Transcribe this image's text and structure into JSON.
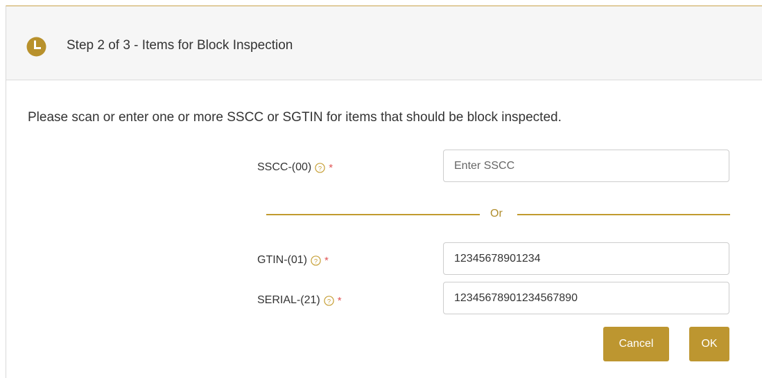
{
  "header": {
    "title": "Step 2 of 3 - Items for Block Inspection",
    "icon": "clock-icon"
  },
  "instruction": "Please scan or enter one or more SSCC or SGTIN for items that should be block inspected.",
  "form": {
    "sscc": {
      "label": "SSCC-(00)",
      "required_marker": "*",
      "placeholder": "Enter SSCC",
      "value": ""
    },
    "separator": "Or",
    "gtin": {
      "label": "GTIN-(01)",
      "required_marker": "*",
      "value": "12345678901234"
    },
    "serial": {
      "label": "SERIAL-(21)",
      "required_marker": "*",
      "value": "12345678901234567890"
    }
  },
  "buttons": {
    "cancel": "Cancel",
    "ok": "OK"
  },
  "colors": {
    "accent": "#bd9630",
    "divider": "#c19a2e",
    "required": "#e05555"
  }
}
